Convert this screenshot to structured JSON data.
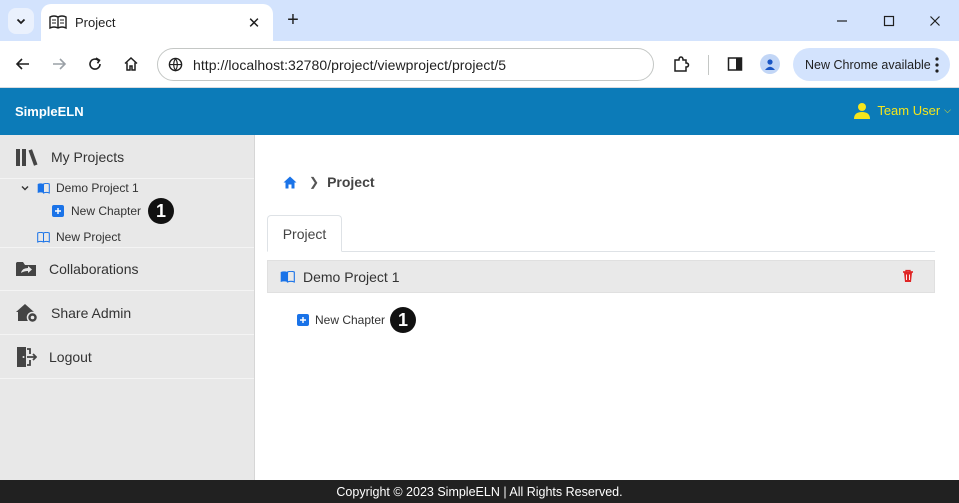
{
  "browser": {
    "tab_title": "Project",
    "url": "http://localhost:32780/project/viewproject/project/5",
    "update_label": "New Chrome available"
  },
  "app": {
    "brand": "SimpleELN",
    "user_label": "Team User",
    "accent_color": "#0c7bb8",
    "user_color": "#f5e51c"
  },
  "sidebar": {
    "my_projects": "My Projects",
    "tree": {
      "project_name": "Demo Project 1",
      "new_chapter": "New Chapter",
      "new_project": "New Project"
    },
    "collaborations": "Collaborations",
    "share_admin": "Share Admin",
    "logout": "Logout"
  },
  "annotations": {
    "marker_1": "1"
  },
  "main": {
    "breadcrumb_current": "Project",
    "tab_label": "Project",
    "project_title": "Demo Project 1",
    "new_chapter": "New Chapter"
  },
  "footer": {
    "text": "Copyright © 2023 SimpleELN | All Rights Reserved."
  }
}
